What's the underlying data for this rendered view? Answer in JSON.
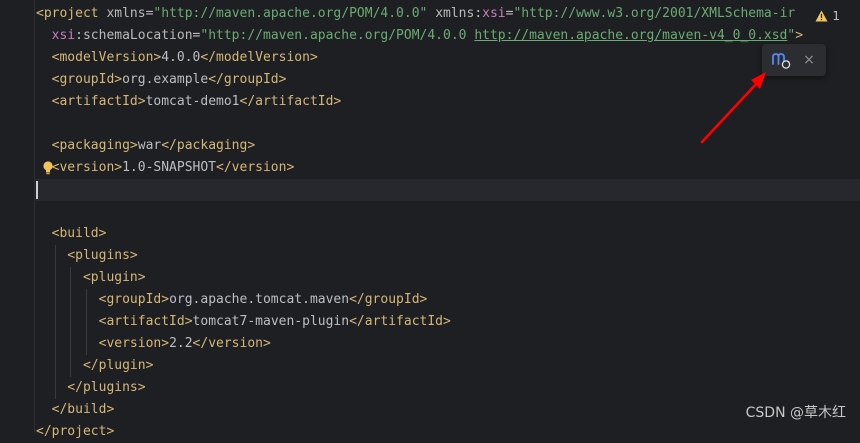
{
  "editor": {
    "lines": [
      {
        "segments": [
          {
            "t": "<project ",
            "c": "tag"
          },
          {
            "t": "xmlns",
            "c": "attr"
          },
          {
            "t": "=",
            "c": "plain"
          },
          {
            "t": "\"http://maven.apache.org/POM/4.0.0\"",
            "c": "val"
          },
          {
            "t": " ",
            "c": "plain"
          },
          {
            "t": "xmlns",
            "c": "attr"
          },
          {
            "t": ":",
            "c": "plain"
          },
          {
            "t": "xsi",
            "c": "ns"
          },
          {
            "t": "=",
            "c": "plain"
          },
          {
            "t": "\"http://www.w3.org/2001/XMLSchema-ir",
            "c": "val"
          }
        ]
      },
      {
        "segments": [
          {
            "t": "  ",
            "c": "plain"
          },
          {
            "t": "xsi",
            "c": "ns"
          },
          {
            "t": ":schemaLocation",
            "c": "attr"
          },
          {
            "t": "=",
            "c": "plain"
          },
          {
            "t": "\"http://maven.apache.org/POM/4.0.0 ",
            "c": "val"
          },
          {
            "t": "http://maven.apache.org/maven-v4_0_0.xsd",
            "c": "val link"
          },
          {
            "t": "\"",
            "c": "val"
          },
          {
            "t": ">",
            "c": "tag"
          }
        ]
      },
      {
        "segments": [
          {
            "t": "  <modelVersion>",
            "c": "tag"
          },
          {
            "t": "4.0.0",
            "c": "plain"
          },
          {
            "t": "</modelVersion>",
            "c": "tag"
          }
        ]
      },
      {
        "segments": [
          {
            "t": "  <groupId>",
            "c": "tag"
          },
          {
            "t": "org.example",
            "c": "plain"
          },
          {
            "t": "</groupId>",
            "c": "tag"
          }
        ]
      },
      {
        "segments": [
          {
            "t": "  <artifactId>",
            "c": "tag"
          },
          {
            "t": "tomcat-demo1",
            "c": "plain"
          },
          {
            "t": "</artifactId>",
            "c": "tag"
          }
        ]
      },
      {
        "segments": []
      },
      {
        "segments": [
          {
            "t": "  <packaging>",
            "c": "tag"
          },
          {
            "t": "war",
            "c": "plain"
          },
          {
            "t": "</packaging>",
            "c": "tag"
          }
        ]
      },
      {
        "segments": [
          {
            "t": "  <version>",
            "c": "tag"
          },
          {
            "t": "1.0-SNAPSHOT",
            "c": "plain"
          },
          {
            "t": "</version>",
            "c": "tag"
          }
        ]
      },
      {
        "segments": [],
        "current": true
      },
      {
        "segments": []
      },
      {
        "segments": [
          {
            "t": "  <build>",
            "c": "tag"
          }
        ]
      },
      {
        "segments": [
          {
            "t": "    <plugins>",
            "c": "tag"
          }
        ]
      },
      {
        "segments": [
          {
            "t": "      <plugin>",
            "c": "tag"
          }
        ]
      },
      {
        "segments": [
          {
            "t": "        <groupId>",
            "c": "tag"
          },
          {
            "t": "org.apache.tomcat.maven",
            "c": "plain"
          },
          {
            "t": "</groupId>",
            "c": "tag"
          }
        ]
      },
      {
        "segments": [
          {
            "t": "        <artifactId>",
            "c": "tag"
          },
          {
            "t": "tomcat7-maven-plugin",
            "c": "plain"
          },
          {
            "t": "</artifactId>",
            "c": "tag"
          }
        ]
      },
      {
        "segments": [
          {
            "t": "        <version>",
            "c": "tag"
          },
          {
            "t": "2.2",
            "c": "plain"
          },
          {
            "t": "</version>",
            "c": "tag"
          }
        ]
      },
      {
        "segments": [
          {
            "t": "      </plugin>",
            "c": "tag"
          }
        ]
      },
      {
        "segments": [
          {
            "t": "    </plugins>",
            "c": "tag"
          }
        ]
      },
      {
        "segments": [
          {
            "t": "  </build>",
            "c": "tag"
          }
        ]
      },
      {
        "segments": [
          {
            "t": "</project>",
            "c": "tag"
          }
        ]
      }
    ]
  },
  "inspection": {
    "icon": "warning-triangle-icon",
    "count": "1",
    "up_icon": "chevron-up-icon"
  },
  "maven_popup": {
    "load_icon": "maven-load-changes-icon",
    "close_label": "×",
    "close_icon": "close-icon"
  },
  "annotation": {
    "arrow_color": "#ff0000"
  },
  "watermark": {
    "text": "CSDN @草木红"
  },
  "colors": {
    "background": "#1e1f22",
    "tag": "#d5b778",
    "attribute": "#bababa",
    "namespace": "#c77dbb",
    "string": "#6aab73",
    "text": "#bcbec4",
    "current_line": "#26282e"
  }
}
